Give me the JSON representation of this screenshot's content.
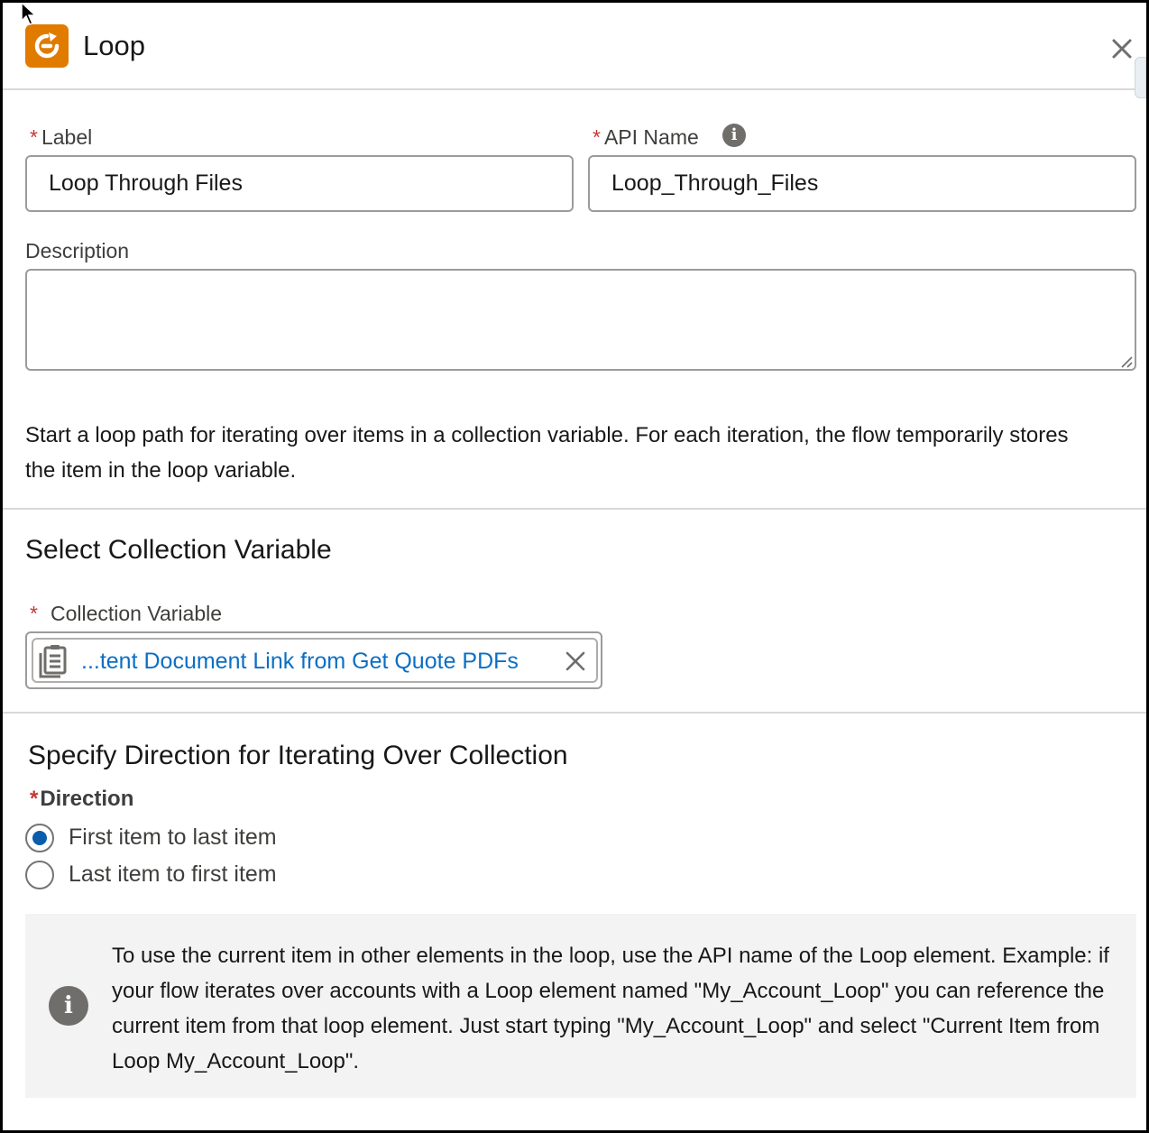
{
  "header": {
    "title": "Loop",
    "icon": "loop-refresh-icon",
    "accent": "#e17b00"
  },
  "form": {
    "required_marker": "*",
    "label": {
      "text": "Label",
      "value": "Loop Through Files"
    },
    "api_name": {
      "text": "API Name",
      "value": "Loop_Through_Files"
    },
    "description": {
      "text": "Description",
      "value": ""
    }
  },
  "intro_text": "Start a loop path for iterating over items in a collection variable. For each iteration, the flow temporarily stores the item in the loop variable.",
  "collection": {
    "section_title": "Select Collection Variable",
    "field_label": "Collection Variable",
    "selected_value": "...tent Document Link from Get Quote PDFs",
    "link_color": "#0b6fc4"
  },
  "direction": {
    "section_title": "Specify Direction for Iterating Over Collection",
    "field_label": "Direction",
    "options": [
      {
        "label": "First item to last item",
        "checked": true
      },
      {
        "label": "Last item to first item",
        "checked": false
      }
    ]
  },
  "info_box": {
    "text": "To use the current item in other elements in the loop, use the API name of the Loop element. Example: if your flow iterates over accounts with a Loop element named \"My_Account_Loop\" you can reference the current item from that loop element. Just start typing \"My_Account_Loop\" and select \"Current Item from Loop My_Account_Loop\"."
  }
}
